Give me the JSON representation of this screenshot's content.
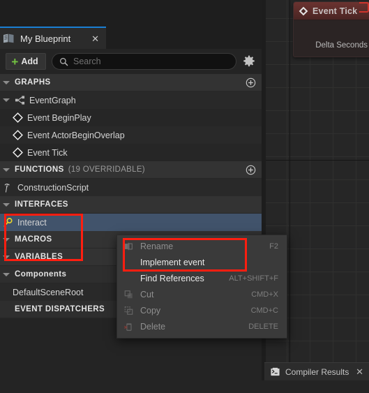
{
  "graph": {
    "node": {
      "title": "Event Tick",
      "title_icon": "event-diamond-icon",
      "delta_label": "Delta Seconds",
      "header_color": "#6b3330",
      "pin_color": "#1faa28"
    }
  },
  "compiler": {
    "label": "Compiler Results",
    "icon": "compiler-output-icon",
    "close": "✕"
  },
  "panel": {
    "tab": {
      "label": "My Blueprint",
      "icon": "blueprint-book-icon",
      "close": "✕",
      "accent_color": "#1a7fd4"
    },
    "toolbar": {
      "add_label": "Add",
      "add_plus": "+",
      "search_placeholder": "Search",
      "search_value": "",
      "search_icon": "search-icon",
      "settings_icon": "gear-icon"
    },
    "sections": [
      {
        "title": "GRAPHS",
        "subtitle": "",
        "has_add": true,
        "rows": [
          {
            "label": "EventGraph",
            "icon": "event-graph-icon",
            "indent": 0,
            "selected": false,
            "bold": false
          },
          {
            "label": "Event BeginPlay",
            "icon": "event-node-icon",
            "indent": 1,
            "selected": false,
            "bold": false
          },
          {
            "label": "Event ActorBeginOverlap",
            "icon": "event-node-icon",
            "indent": 1,
            "selected": false,
            "bold": false
          },
          {
            "label": "Event Tick",
            "icon": "event-node-icon",
            "indent": 1,
            "selected": false,
            "bold": false
          }
        ]
      },
      {
        "title": "FUNCTIONS",
        "subtitle": "(19 OVERRIDABLE)",
        "has_add": true,
        "rows": [
          {
            "label": "ConstructionScript",
            "icon": "function-icon",
            "indent": 0,
            "selected": false,
            "bold": false
          }
        ]
      },
      {
        "title": "INTERFACES",
        "subtitle": "",
        "has_add": false,
        "rows": [
          {
            "label": "Interact",
            "icon": "interface-icon",
            "indent": 0,
            "selected": true,
            "bold": false
          }
        ]
      },
      {
        "title": "MACROS",
        "subtitle": "",
        "has_add": false,
        "rows": []
      },
      {
        "title": "VARIABLES",
        "subtitle": "",
        "has_add": false,
        "rows": []
      },
      {
        "title": "Components",
        "subtitle": "",
        "has_add": false,
        "mixed_case": true,
        "rows": [
          {
            "label": "DefaultSceneRoot",
            "icon": "",
            "indent": 1,
            "selected": false,
            "bold": false
          }
        ]
      },
      {
        "title": "EVENT DISPATCHERS",
        "subtitle": "",
        "has_add": false,
        "rows": []
      }
    ]
  },
  "context_menu": {
    "items": [
      {
        "label": "Rename",
        "shortcut": "F2",
        "icon": "rename-icon",
        "enabled": false
      },
      {
        "label": "Implement event",
        "shortcut": "",
        "icon": "",
        "enabled": true
      },
      {
        "label": "Find References",
        "shortcut": "ALT+SHIFT+F",
        "icon": "",
        "enabled": true
      },
      {
        "label": "Cut",
        "shortcut": "CMD+X",
        "icon": "cut-icon",
        "enabled": false
      },
      {
        "label": "Copy",
        "shortcut": "CMD+C",
        "icon": "copy-icon",
        "enabled": false
      },
      {
        "label": "Delete",
        "shortcut": "DELETE",
        "icon": "delete-icon",
        "enabled": false
      }
    ]
  },
  "annotations": {
    "highlight_color": "#ff1e10",
    "boxes": [
      "interfaces-interact-box",
      "implement-event-box"
    ]
  }
}
